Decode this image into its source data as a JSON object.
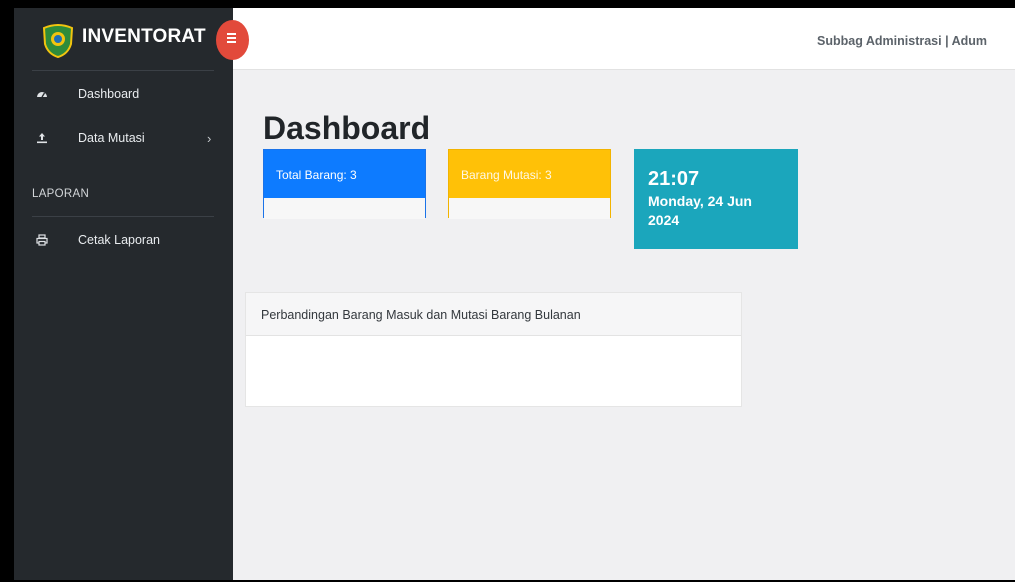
{
  "brand": {
    "title": "INVENTORAT",
    "logo_icon": "emblem-shield-icon"
  },
  "sidebar": {
    "items": [
      {
        "label": "Dashboard",
        "icon": "gauge-icon"
      },
      {
        "label": "Data Mutasi",
        "icon": "upload-icon",
        "caret": "›"
      }
    ],
    "section_heading": "LAPORAN",
    "report_items": [
      {
        "label": "Cetak Laporan",
        "icon": "print-icon"
      }
    ]
  },
  "topbar": {
    "user_text": "Subbag Administrasi | Adum"
  },
  "page": {
    "title": "Dashboard"
  },
  "cards": {
    "total": {
      "label": "Total Barang: 3",
      "color": "#0d7bff"
    },
    "mutasi": {
      "label": "Barang Mutasi: 3",
      "color": "#ffc107"
    }
  },
  "clock": {
    "time": "21:07",
    "date": "Monday, 24 Jun 2024",
    "color": "#1ba6bc"
  },
  "panel": {
    "title": "Perbandingan Barang Masuk dan Mutasi Barang Bulanan"
  },
  "colors": {
    "sidebar_bg": "#25292d",
    "toggle_btn": "#e24a3b"
  }
}
